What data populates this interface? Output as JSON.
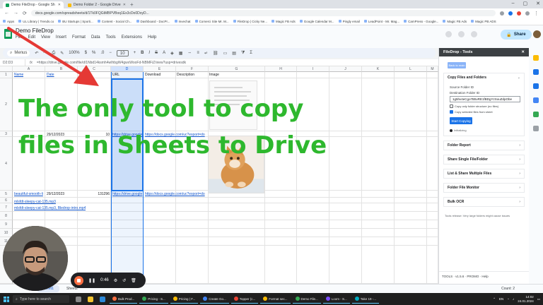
{
  "browser": {
    "tabs": [
      {
        "label": "Demo FileDrop - Google Sh",
        "active": true
      },
      {
        "label": "Demo Folder 2 - Google Drive",
        "active": false
      }
    ],
    "url": "docs.google.com/spreadsheets/d/1Tk0FQGtMBPVBoq1Ex3cDo0DoyD...",
    "bookmarks": [
      "Apps",
      "UL Library | Trends.co",
      "BU Startups | Sporti...",
      "Content - Social Ch...",
      "Dashboard - DocPr...",
      "Invechat",
      "Comerci Site Mr. M...",
      "FileDrop | Cicky Ne...",
      "Magic FB Ads",
      "Google Calendar M...",
      "Pingly email",
      "LeadPoint - Mr. Mag...",
      "CamPress - Google...",
      "Magic FB Ads",
      "Magic PB ADS"
    ]
  },
  "sheets": {
    "title": "Demo FileDrop",
    "menu": [
      "File",
      "Edit",
      "View",
      "Insert",
      "Format",
      "Data",
      "Tools",
      "Extensions",
      "Help"
    ],
    "toolbar": {
      "menus_label": "Menus",
      "zoom": "100%",
      "font_size": "10"
    },
    "share_label": "Share",
    "cell_ref": "D2:D3",
    "formula": "=https://drive.google.com/file/d/1Nbd14ksmh4wIhbgW4gwxWooFd-NBMFiZ/view?usp=drivesdk"
  },
  "grid": {
    "columns": [
      "A",
      "B",
      "C",
      "D",
      "E",
      "F",
      "G",
      "H",
      "I",
      "J",
      "K",
      "L",
      "M"
    ],
    "selected_column": "D",
    "header_row": {
      "name": "Name",
      "date": "Date",
      "url": "URL",
      "download": "Download",
      "description": "Description",
      "image": "Image"
    },
    "rows": [
      {
        "num": "1"
      },
      {
        "num": "2"
      },
      {
        "num": "3"
      },
      {
        "num": "4"
      },
      {
        "num": "5"
      },
      {
        "num": "6"
      },
      {
        "num": "7"
      },
      {
        "num": "8"
      },
      {
        "num": "9"
      },
      {
        "num": "10"
      },
      {
        "num": "11"
      },
      {
        "num": "12"
      }
    ],
    "data": [
      {
        "name": "",
        "date": "29/12/2023",
        "size": "10",
        "url": "https://drive.google",
        "download": "https://docs.google.com/uc?export=do"
      },
      {
        "name": "beautiful-smooth-li",
        "date": "29/12/2023",
        "size": "131296",
        "url": "https://drive.google",
        "download": "https://docs.google.com/uc?export=do"
      }
    ],
    "extra_links": [
      "mlsfdt-sleepy-cat-135.mp3",
      "mlsfdt-sleepy-cat-135.mp3, Bledrop-intro.mp4"
    ]
  },
  "overlay": {
    "line1": "The only tool to copy",
    "line2": "files in Sheets to Drive",
    "color": "#2eb82e",
    "arrow_color": "#e53935"
  },
  "panel": {
    "title": "FileDrop - Tools",
    "back_label": "Back to main",
    "copy_section": {
      "title": "Copy Files and Folders",
      "source_label": "Source Folder ID",
      "dest_label": "Destination Folder ID",
      "dest_value": "1g5hv4eCgo7B5vRE1fBDgYzSouZdpObe",
      "opt1": "Copy only folder structure (no files)",
      "opt2": "Copy selected files from sheet",
      "start_label": "Start Copying",
      "status": "Initializing"
    },
    "sections": [
      "Folder Report",
      "Share Single File/Folder",
      "List & Share Multiple Files",
      "Folder File Monitor",
      "Bulk OCR"
    ],
    "hint": "Tools release: Very large folders might cause issues",
    "footer": "TOOLS · v1.5.6 · PROMO · Help"
  },
  "bottom": {
    "sheet1": "Sheet1",
    "sheet2": "Sheet2",
    "count": "Count: 2",
    "rec_time": "0:46"
  },
  "taskbar": {
    "search_placeholder": "Type here to search",
    "windows": [
      "Bulk Prod...",
      "Pricing - S...",
      "Pricing | F...",
      "Create Go...",
      "Topper (c...",
      "Format sec...",
      "Demo File...",
      "Loom - S...",
      "Take 19 -..."
    ],
    "time": "14:02",
    "date": "24.01.2024",
    "lang": "EN"
  }
}
